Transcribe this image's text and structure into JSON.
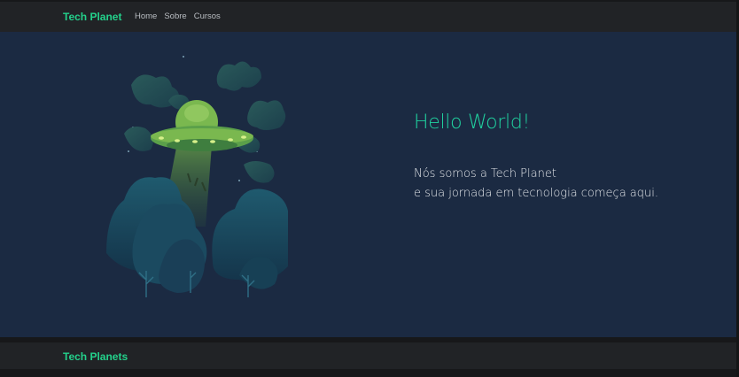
{
  "navbar": {
    "brand": "Tech Planet",
    "links": [
      "Home",
      "Sobre",
      "Cursos"
    ]
  },
  "hero": {
    "title": "Hello World!",
    "line1": "Nós somos a Tech Planet",
    "line2": "e sua jornada em tecnologia começa aqui.",
    "illustration_icon": "ufo-abducting-illustration"
  },
  "footer": {
    "brand": "Tech Planets"
  },
  "colors": {
    "accent": "#23d18b",
    "hero_bg": "#1b2a42",
    "nav_bg": "#212326"
  }
}
